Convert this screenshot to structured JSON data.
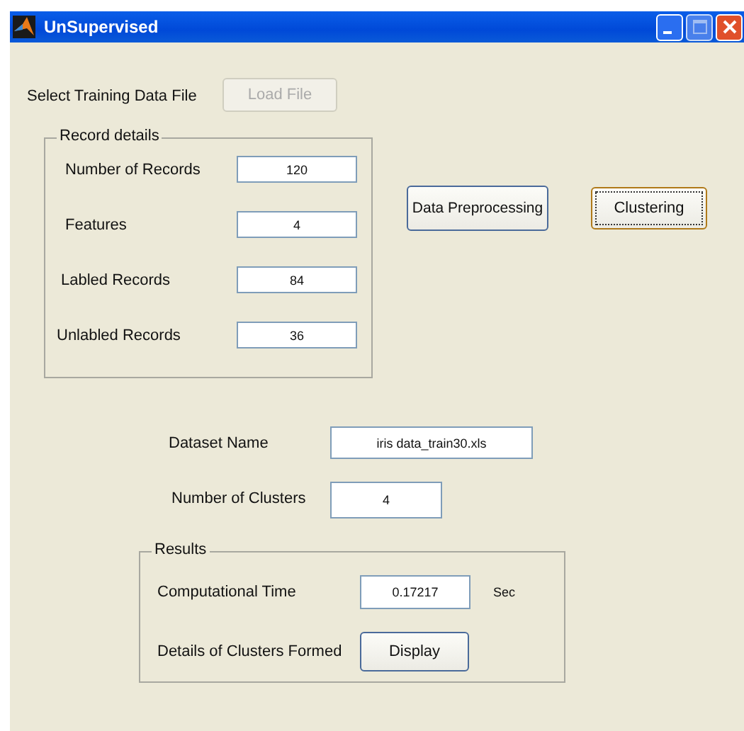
{
  "window": {
    "title": "UnSupervised"
  },
  "file_row": {
    "label": "Select Training Data File",
    "button": {
      "label": "Load File",
      "disabled": true
    }
  },
  "record_details": {
    "title": "Record details",
    "rows": [
      {
        "label": "Number of Records",
        "value": "120"
      },
      {
        "label": "Features",
        "value": "4"
      },
      {
        "label": "Labled Records",
        "value": "84"
      },
      {
        "label": "Unlabled Records",
        "value": "36"
      }
    ]
  },
  "actions": [
    {
      "label": "Data Preprocessing",
      "focused": false
    },
    {
      "label": "Clustering",
      "focused": true
    }
  ],
  "dataset_fields": [
    {
      "label": "Dataset Name",
      "value": "iris data_train30.xls"
    },
    {
      "label": "Number of Clusters",
      "value": "4"
    }
  ],
  "results": {
    "title": "Results",
    "time_label": "Computational Time",
    "time_value": "0.17217",
    "time_unit": "Sec",
    "details_label": "Details of Clusters Formed",
    "display_button": {
      "label": "Display",
      "disabled": false
    }
  }
}
